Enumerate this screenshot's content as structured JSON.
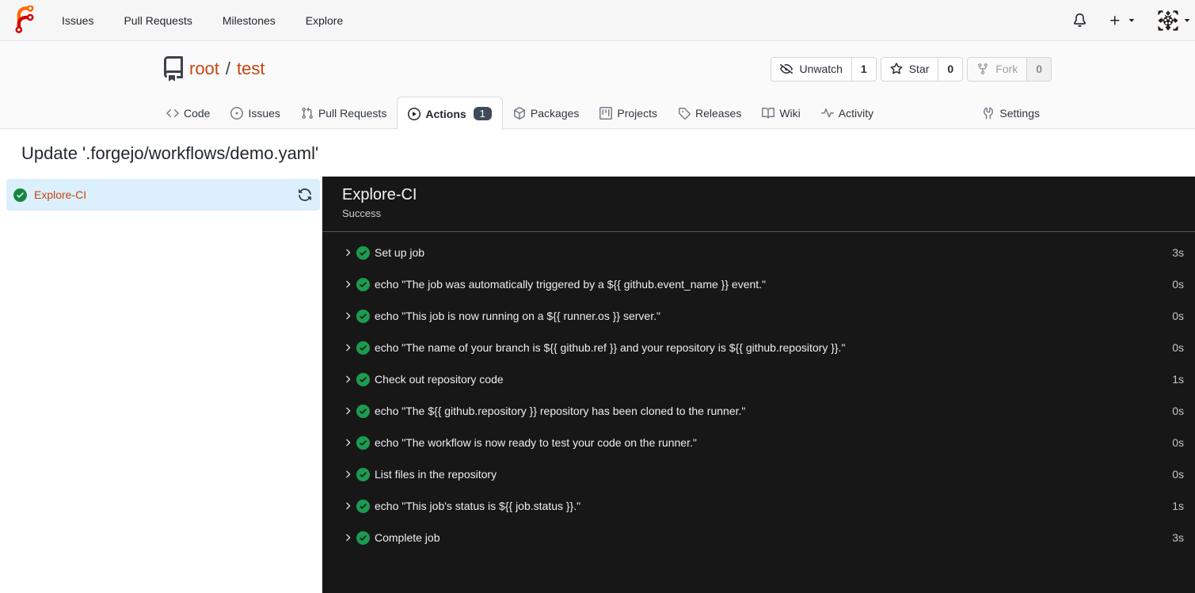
{
  "navbar": {
    "logo_icon": "forgejo-logo",
    "items": [
      {
        "label": "Issues"
      },
      {
        "label": "Pull Requests"
      },
      {
        "label": "Milestones"
      },
      {
        "label": "Explore"
      }
    ],
    "bell_icon": "bell-icon",
    "create_icon": "plus-icon",
    "avatar_icon": "avatar-identicon",
    "caret_icon": "caret-down-icon"
  },
  "repo": {
    "icon": "repo-icon",
    "owner": "root",
    "separator": "/",
    "name": "test",
    "buttons": [
      {
        "label": "Unwatch",
        "count": "1",
        "icon": "eye-slash-icon",
        "disabled": false
      },
      {
        "label": "Star",
        "count": "0",
        "icon": "star-icon",
        "disabled": false
      },
      {
        "label": "Fork",
        "count": "0",
        "icon": "fork-icon",
        "disabled": true
      }
    ],
    "tabs": [
      {
        "label": "Code",
        "icon": "code-icon"
      },
      {
        "label": "Issues",
        "icon": "issue-icon"
      },
      {
        "label": "Pull Requests",
        "icon": "pull-request-icon"
      },
      {
        "label": "Actions",
        "icon": "play-circle-icon",
        "active": true,
        "badge": "1"
      },
      {
        "label": "Packages",
        "icon": "package-icon"
      },
      {
        "label": "Projects",
        "icon": "project-icon"
      },
      {
        "label": "Releases",
        "icon": "tag-icon"
      },
      {
        "label": "Wiki",
        "icon": "book-icon"
      },
      {
        "label": "Activity",
        "icon": "pulse-icon"
      }
    ],
    "settings_tab": {
      "label": "Settings",
      "icon": "tools-icon"
    }
  },
  "run": {
    "title": "Update '.forgejo/workflows/demo.yaml'",
    "job": {
      "name": "Explore-CI",
      "status_icon": "check-circle-icon",
      "rerun_icon": "sync-icon"
    },
    "log": {
      "title": "Explore-CI",
      "status_text": "Success",
      "steps": [
        {
          "label": "Set up job",
          "duration": "3s"
        },
        {
          "label": "echo \"The job was automatically triggered by a ${{ github.event_name }} event.\"",
          "duration": "0s"
        },
        {
          "label": "echo \"This job is now running on a ${{ runner.os }} server.\"",
          "duration": "0s"
        },
        {
          "label": "echo \"The name of your branch is ${{ github.ref }} and your repository is ${{ github.repository }}.\"",
          "duration": "0s"
        },
        {
          "label": "Check out repository code",
          "duration": "1s"
        },
        {
          "label": "echo \"The ${{ github.repository }} repository has been cloned to the runner.\"",
          "duration": "0s"
        },
        {
          "label": "echo \"The workflow is now ready to test your code on the runner.\"",
          "duration": "0s"
        },
        {
          "label": "List files in the repository",
          "duration": "0s"
        },
        {
          "label": "echo \"This job's status is ${{ job.status }}.\"",
          "duration": "1s"
        },
        {
          "label": "Complete job",
          "duration": "3s"
        }
      ]
    }
  },
  "colors": {
    "primary_link": "#c4460e",
    "logo_orange": "#ff6600",
    "logo_red": "#d40000",
    "success_green_light": "#17863c",
    "success_green_dark": "#1c9b50",
    "selected_job_bg": "#dbeffd",
    "console_bg": "#171717",
    "badge_bg": "#404a59"
  }
}
